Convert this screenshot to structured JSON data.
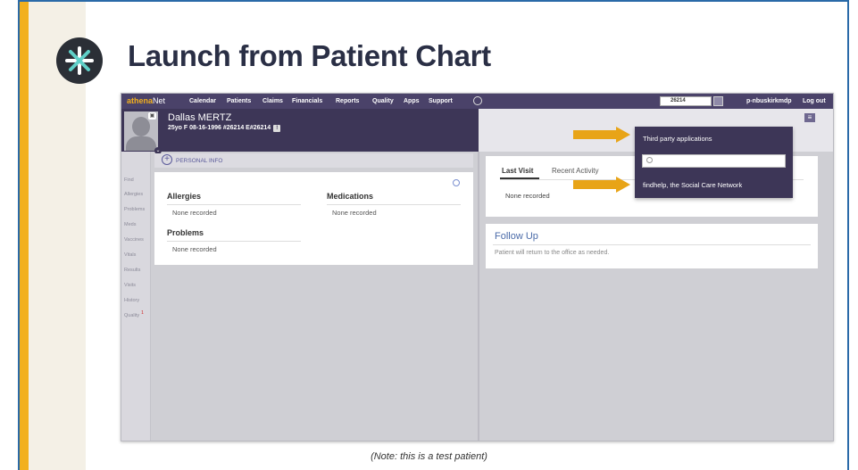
{
  "slide": {
    "title": "Launch from Patient Chart",
    "note": "(Note: this is a test patient)"
  },
  "colors": {
    "accent_gold": "#f2b01e",
    "nav_purple": "#4a4269",
    "header_purple": "#3d3657",
    "frame_blue": "#2a6aa8"
  },
  "topnav": {
    "brand_prefix": "athena",
    "brand_suffix": "Net",
    "items": [
      "Calendar",
      "Patients",
      "Claims",
      "Financials",
      "Reports",
      "Quality",
      "Apps",
      "Support"
    ],
    "search_value": "26214",
    "user": "p-nbuskirkmdp",
    "logout": "Log out"
  },
  "patient": {
    "name": "Dallas MERTZ",
    "info": "25yo F  08-16-1996  #26214  E#26214",
    "flag": "!"
  },
  "sidebar": {
    "items": [
      "Find",
      "Allergies",
      "Problems",
      "Meds",
      "Vaccines",
      "Vitals",
      "Results",
      "Visits",
      "History",
      "Quality"
    ]
  },
  "personal_info": {
    "label": "PERSONAL INFO"
  },
  "summary": {
    "allergies_title": "Allergies",
    "allergies_value": "None recorded",
    "medications_title": "Medications",
    "medications_value": "None recorded",
    "problems_title": "Problems",
    "problems_value": "None recorded"
  },
  "visit": {
    "tab_last": "Last Visit",
    "tab_recent": "Recent Activity",
    "value": "None recorded"
  },
  "follow_up": {
    "title": "Follow Up",
    "text": "Patient will return to the office as needed."
  },
  "dropdown": {
    "title": "Third party applications",
    "search_placeholder": "",
    "item": "findhelp, the Social Care Network"
  },
  "icons": [
    "logo-icon",
    "gear-icon",
    "search-icon",
    "camera-icon",
    "hamburger-icon",
    "plus-icon",
    "chevron-down-icon",
    "arrow-icon"
  ]
}
